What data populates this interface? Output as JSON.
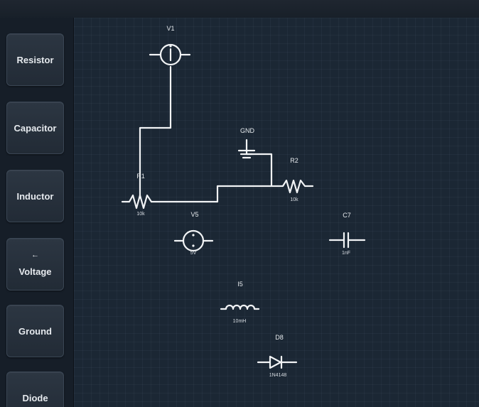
{
  "palette": {
    "items": [
      {
        "label": "Resistor",
        "glyph": ""
      },
      {
        "label": "Capacitor",
        "glyph": ""
      },
      {
        "label": "Inductor",
        "glyph": ""
      },
      {
        "label": "Voltage",
        "glyph": "←"
      },
      {
        "label": "Ground",
        "glyph": ""
      },
      {
        "label": "Diode",
        "glyph": ""
      }
    ]
  },
  "components": {
    "v1": {
      "label": "V1",
      "value": ""
    },
    "gnd": {
      "label": "GND",
      "value": ""
    },
    "r1": {
      "label": "R1",
      "value": "10k"
    },
    "r2": {
      "label": "R2",
      "value": "10k"
    },
    "v5": {
      "label": "V5",
      "value": "5V"
    },
    "c7": {
      "label": "C7",
      "value": "1nF"
    },
    "i5": {
      "label": "I5",
      "value": "10mH"
    },
    "d8": {
      "label": "D8",
      "value": "1N4148"
    }
  },
  "colors": {
    "background": "#141b24",
    "canvas": "#1b2734",
    "wire": "#f2f4f6",
    "button": "#2c3642"
  }
}
